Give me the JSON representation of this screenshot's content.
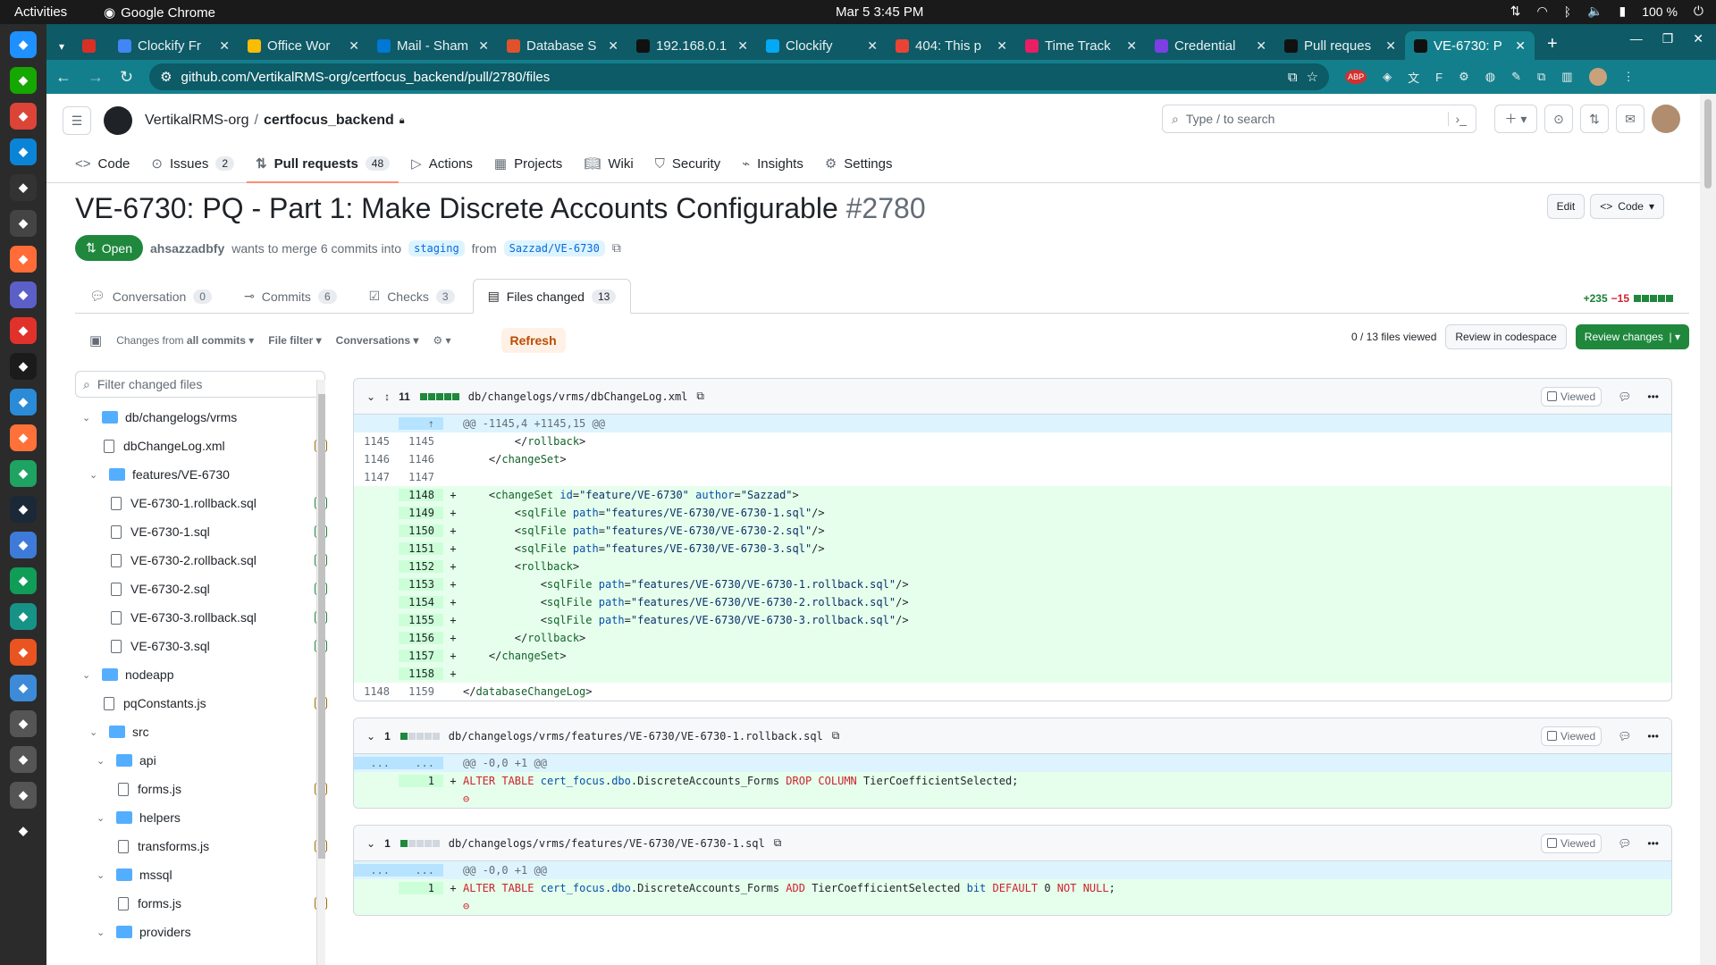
{
  "os": {
    "activities": "Activities",
    "app_name": "Google Chrome",
    "clock": "Mar 5  3:45 PM",
    "battery": "100 %"
  },
  "dock": [
    {
      "icon": "bluetooth-app-icon",
      "color": "#1e90ff"
    },
    {
      "icon": "upwork-icon",
      "color": "#14a800"
    },
    {
      "icon": "chrome-icon",
      "color": "#db4437"
    },
    {
      "icon": "vscode-icon",
      "color": "#0a84d6"
    },
    {
      "icon": "terminal-icon",
      "color": "#333333"
    },
    {
      "icon": "typora-icon",
      "color": "#444444"
    },
    {
      "icon": "postman-icon",
      "color": "#ff6c37"
    },
    {
      "icon": "teams-icon",
      "color": "#5b5fc7"
    },
    {
      "icon": "settings-icon",
      "color": "#e0322b"
    },
    {
      "icon": "inkscape-icon",
      "color": "#1b1b1b"
    },
    {
      "icon": "xreader-icon",
      "color": "#2a8bd8"
    },
    {
      "icon": "firefox-icon",
      "color": "#ff7139"
    },
    {
      "icon": "sheets-icon",
      "color": "#1ea362"
    },
    {
      "icon": "steam-icon",
      "color": "#1b2838"
    },
    {
      "icon": "editor-icon",
      "color": "#3e7bd8"
    },
    {
      "icon": "chat-icon",
      "color": "#0f9d58"
    },
    {
      "icon": "gitkraken-icon",
      "color": "#179287"
    },
    {
      "icon": "ubuntu-icon",
      "color": "#e95420"
    },
    {
      "icon": "box-icon",
      "color": "#3d8bd8"
    },
    {
      "icon": "disk1-icon",
      "color": "#555555"
    },
    {
      "icon": "disk2-icon",
      "color": "#555555"
    },
    {
      "icon": "disk3-icon",
      "color": "#555555"
    },
    {
      "icon": "apps-grid-icon",
      "color": "#2b2b2b"
    }
  ],
  "tabs": [
    {
      "title": "",
      "color": "#d93025"
    },
    {
      "title": "Clockify Fr",
      "color": "#4285f4"
    },
    {
      "title": "Office Wor",
      "color": "#fbbc04"
    },
    {
      "title": "Mail - Sham",
      "color": "#0078d4"
    },
    {
      "title": "Database S",
      "color": "#e0522b"
    },
    {
      "title": "192.168.0.1",
      "color": "#111111"
    },
    {
      "title": "Clockify",
      "color": "#03a9f4"
    },
    {
      "title": "404: This p",
      "color": "#ea4335"
    },
    {
      "title": "Time Track",
      "color": "#e91e63"
    },
    {
      "title": "Credential",
      "color": "#7b3fe4"
    },
    {
      "title": "Pull reques",
      "color": "#111111"
    },
    {
      "title": "VE-6730: P",
      "color": "#111111"
    }
  ],
  "url": "github.com/VertikalRMS-org/certfocus_backend/pull/2780/files",
  "gh": {
    "org": "VertikalRMS-org",
    "repo": "certfocus_backend",
    "search_placeholder": "Type / to search",
    "nav": [
      {
        "label": "Code",
        "count": ""
      },
      {
        "label": "Issues",
        "count": "2"
      },
      {
        "label": "Pull requests",
        "count": "48"
      },
      {
        "label": "Actions",
        "count": ""
      },
      {
        "label": "Projects",
        "count": ""
      },
      {
        "label": "Wiki",
        "count": ""
      },
      {
        "label": "Security",
        "count": ""
      },
      {
        "label": "Insights",
        "count": ""
      },
      {
        "label": "Settings",
        "count": ""
      }
    ]
  },
  "pr": {
    "title": "VE-6730: PQ - Part 1: Make Discrete Accounts Configurable",
    "number": "#2780",
    "edit": "Edit",
    "code_btn": "Code",
    "status": "Open",
    "author": "ahsazzadbfy",
    "meta_text": "wants to merge 6 commits into",
    "base": "staging",
    "from": "from",
    "head": "Sazzad/VE-6730",
    "tabs": [
      {
        "label": "Conversation",
        "count": "0"
      },
      {
        "label": "Commits",
        "count": "6"
      },
      {
        "label": "Checks",
        "count": "3"
      },
      {
        "label": "Files changed",
        "count": "13"
      }
    ],
    "additions": "+235",
    "deletions": "−15"
  },
  "toolbar": {
    "changes_from": "Changes from",
    "all_commits": "all commits",
    "file_filter": "File filter",
    "conversations": "Conversations",
    "refresh": "Refresh",
    "viewed_count": "0 / 13 files viewed",
    "codespace": "Review in codespace",
    "review": "Review changes"
  },
  "tree": {
    "filter_placeholder": "Filter changed files",
    "items": [
      {
        "label": "db/changelogs/vrms",
        "type": "folder",
        "depth": 0,
        "mark": ""
      },
      {
        "label": "dbChangeLog.xml",
        "type": "file",
        "depth": 1,
        "mark": "m"
      },
      {
        "label": "features/VE-6730",
        "type": "folder",
        "depth": 1,
        "mark": ""
      },
      {
        "label": "VE-6730-1.rollback.sql",
        "type": "file",
        "depth": 2,
        "mark": "a"
      },
      {
        "label": "VE-6730-1.sql",
        "type": "file",
        "depth": 2,
        "mark": "a"
      },
      {
        "label": "VE-6730-2.rollback.sql",
        "type": "file",
        "depth": 2,
        "mark": "a"
      },
      {
        "label": "VE-6730-2.sql",
        "type": "file",
        "depth": 2,
        "mark": "a"
      },
      {
        "label": "VE-6730-3.rollback.sql",
        "type": "file",
        "depth": 2,
        "mark": "a"
      },
      {
        "label": "VE-6730-3.sql",
        "type": "file",
        "depth": 2,
        "mark": "a"
      },
      {
        "label": "nodeapp",
        "type": "folder",
        "depth": 0,
        "mark": ""
      },
      {
        "label": "pqConstants.js",
        "type": "file",
        "depth": 1,
        "mark": "m"
      },
      {
        "label": "src",
        "type": "folder",
        "depth": 1,
        "mark": ""
      },
      {
        "label": "api",
        "type": "folder",
        "depth": 2,
        "mark": ""
      },
      {
        "label": "forms.js",
        "type": "file",
        "depth": 3,
        "mark": "m"
      },
      {
        "label": "helpers",
        "type": "folder",
        "depth": 2,
        "mark": ""
      },
      {
        "label": "transforms.js",
        "type": "file",
        "depth": 3,
        "mark": "m"
      },
      {
        "label": "mssql",
        "type": "folder",
        "depth": 2,
        "mark": ""
      },
      {
        "label": "forms.js",
        "type": "file",
        "depth": 3,
        "mark": "m"
      },
      {
        "label": "providers",
        "type": "folder",
        "depth": 2,
        "mark": ""
      }
    ]
  },
  "diffs": [
    {
      "count": "11",
      "path": "db/changelogs/vrms/dbChangeLog.xml",
      "viewed": "Viewed",
      "hunk": "@@ -1145,4 +1145,15 @@",
      "lines": [
        {
          "o": "1145",
          "n": "1145",
          "s": "",
          "c": "        </rollback>",
          "t": "ctx"
        },
        {
          "o": "1146",
          "n": "1146",
          "s": "",
          "c": "    </changeSet>",
          "t": "ctx"
        },
        {
          "o": "1147",
          "n": "1147",
          "s": "",
          "c": "",
          "t": "ctx"
        },
        {
          "o": "",
          "n": "1148",
          "s": "+",
          "c": "    <changeSet id=\"feature/VE-6730\" author=\"Sazzad\">",
          "t": "add"
        },
        {
          "o": "",
          "n": "1149",
          "s": "+",
          "c": "        <sqlFile path=\"features/VE-6730/VE-6730-1.sql\"/>",
          "t": "add"
        },
        {
          "o": "",
          "n": "1150",
          "s": "+",
          "c": "        <sqlFile path=\"features/VE-6730/VE-6730-2.sql\"/>",
          "t": "add"
        },
        {
          "o": "",
          "n": "1151",
          "s": "+",
          "c": "        <sqlFile path=\"features/VE-6730/VE-6730-3.sql\"/>",
          "t": "add"
        },
        {
          "o": "",
          "n": "1152",
          "s": "+",
          "c": "        <rollback>",
          "t": "add"
        },
        {
          "o": "",
          "n": "1153",
          "s": "+",
          "c": "            <sqlFile path=\"features/VE-6730/VE-6730-1.rollback.sql\"/>",
          "t": "add"
        },
        {
          "o": "",
          "n": "1154",
          "s": "+",
          "c": "            <sqlFile path=\"features/VE-6730/VE-6730-2.rollback.sql\"/>",
          "t": "add"
        },
        {
          "o": "",
          "n": "1155",
          "s": "+",
          "c": "            <sqlFile path=\"features/VE-6730/VE-6730-3.rollback.sql\"/>",
          "t": "add"
        },
        {
          "o": "",
          "n": "1156",
          "s": "+",
          "c": "        </rollback>",
          "t": "add"
        },
        {
          "o": "",
          "n": "1157",
          "s": "+",
          "c": "    </changeSet>",
          "t": "add"
        },
        {
          "o": "",
          "n": "1158",
          "s": "+",
          "c": "",
          "t": "add"
        },
        {
          "o": "1148",
          "n": "1159",
          "s": "",
          "c": "</databaseChangeLog>",
          "t": "ctx"
        }
      ]
    },
    {
      "count": "1",
      "path": "db/changelogs/vrms/features/VE-6730/VE-6730-1.rollback.sql",
      "viewed": "Viewed",
      "hunk": "@@ -0,0 +1 @@",
      "lines": [
        {
          "o": "",
          "n": "1",
          "s": "+",
          "c": "ALTER TABLE cert_focus.dbo.DiscreteAccounts_Forms DROP COLUMN TierCoefficientSelected;",
          "t": "add"
        }
      ]
    },
    {
      "count": "1",
      "path": "db/changelogs/vrms/features/VE-6730/VE-6730-1.sql",
      "viewed": "Viewed",
      "hunk": "@@ -0,0 +1 @@",
      "lines": [
        {
          "o": "",
          "n": "1",
          "s": "+",
          "c": "ALTER TABLE cert_focus.dbo.DiscreteAccounts_Forms ADD TierCoefficientSelected bit DEFAULT 0 NOT NULL;",
          "t": "add"
        }
      ]
    }
  ]
}
